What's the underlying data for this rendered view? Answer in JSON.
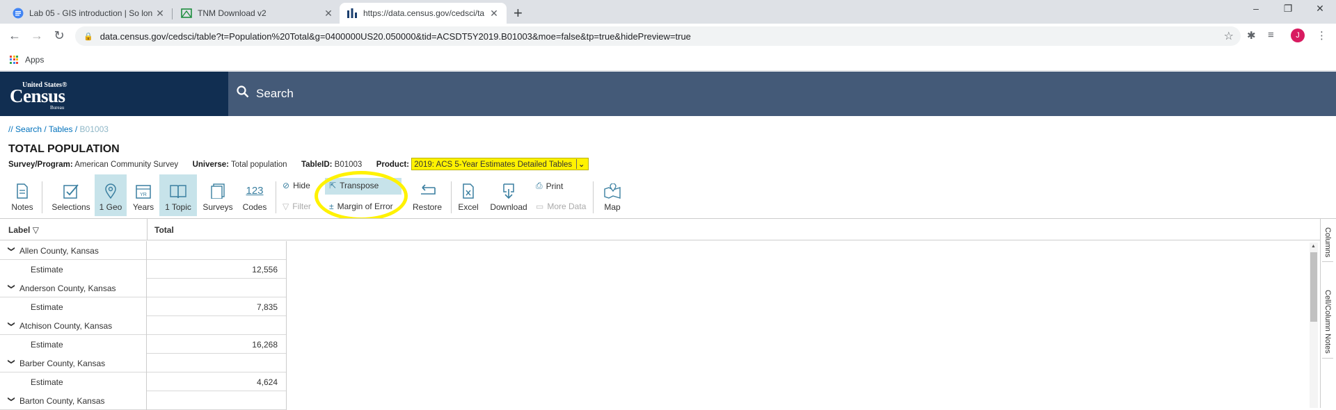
{
  "browser": {
    "tabs": [
      {
        "title": "Lab 05 - GIS introduction | So lon",
        "active": false
      },
      {
        "title": "TNM Download v2",
        "active": false
      },
      {
        "title": "https://data.census.gov/cedsci/ta",
        "active": true
      }
    ],
    "new_tab": "+",
    "url": "data.census.gov/cedsci/table?t=Population%20Total&g=0400000US20.050000&tid=ACSDT5Y2019.B01003&moe=false&tp=true&hidePreview=true",
    "avatar_letter": "J",
    "bookmarks": {
      "apps_label": "Apps"
    },
    "window_controls": {
      "minimize": "–",
      "restore": "❐",
      "close": "✕"
    }
  },
  "census_header": {
    "logo_top": "United States®",
    "logo_main": "Census",
    "logo_bottom": "Bureau",
    "search_label": "Search",
    "colors": {
      "logo_bg": "#112e51",
      "bar_bg": "#445a78"
    }
  },
  "breadcrumb": {
    "prefix": "// ",
    "search": "Search",
    "tables": "Tables",
    "current": "B01003",
    "sep": " / "
  },
  "table": {
    "title": "TOTAL POPULATION",
    "survey_label": "Survey/Program:",
    "survey_value": "American Community Survey",
    "universe_label": "Universe:",
    "universe_value": "Total population",
    "tableid_label": "TableID:",
    "tableid_value": "B01003",
    "product_label": "Product:",
    "product_value": "2019: ACS 5-Year Estimates Detailed Tables"
  },
  "toolbar": {
    "notes": "Notes",
    "selections": "Selections",
    "geo": "1 Geo",
    "years": "Years",
    "topic": "1 Topic",
    "surveys": "Surveys",
    "codes_icon_text": "123",
    "codes": "Codes",
    "hide": "Hide",
    "filter": "Filter",
    "transpose": "Transpose",
    "margin_of_error": "Margin of Error",
    "restore": "Restore",
    "excel": "Excel",
    "download": "Download",
    "print": "Print",
    "more_data": "More Data",
    "map": "Map",
    "highlight_color": "#fff200",
    "selected_bg": "#c7e3ea"
  },
  "grid": {
    "col_label": "Label",
    "col_total": "Total",
    "rows": [
      {
        "type": "county",
        "label": "Allen County, Kansas",
        "value": ""
      },
      {
        "type": "estimate",
        "label": "Estimate",
        "value": "12,556"
      },
      {
        "type": "county",
        "label": "Anderson County, Kansas",
        "value": ""
      },
      {
        "type": "estimate",
        "label": "Estimate",
        "value": "7,835"
      },
      {
        "type": "county",
        "label": "Atchison County, Kansas",
        "value": ""
      },
      {
        "type": "estimate",
        "label": "Estimate",
        "value": "16,268"
      },
      {
        "type": "county",
        "label": "Barber County, Kansas",
        "value": ""
      },
      {
        "type": "estimate",
        "label": "Estimate",
        "value": "4,624"
      },
      {
        "type": "county",
        "label": "Barton County, Kansas",
        "value": ""
      }
    ],
    "side_tabs": {
      "columns": "Columns",
      "cell_notes": "Cell/Column Notes"
    }
  }
}
